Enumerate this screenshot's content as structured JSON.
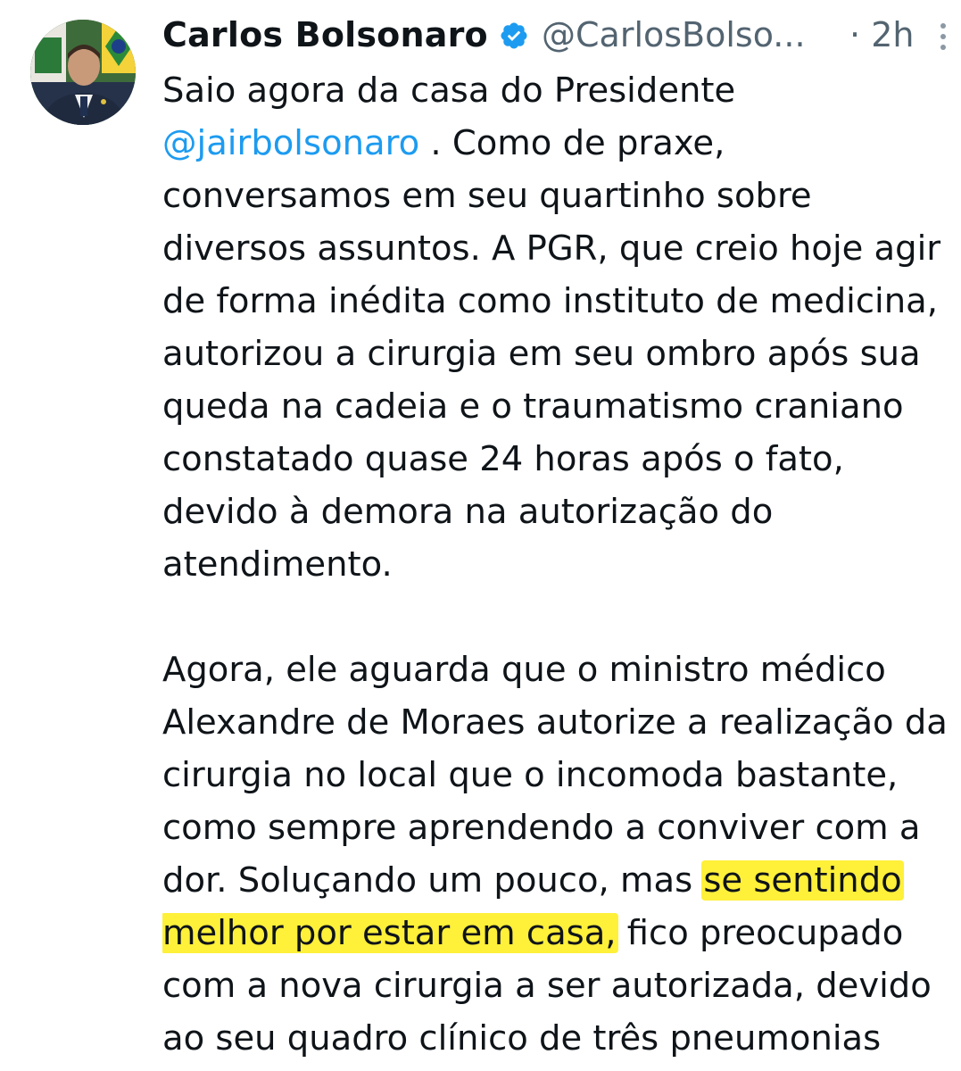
{
  "author": {
    "display_name": "Carlos Bolsonaro",
    "handle": "@CarlosBolso...",
    "time_prefix": "·",
    "time": "2h",
    "verified_icon": "verified-badge-icon",
    "more_icon": "more-vertical-icon"
  },
  "colors": {
    "mention": "#1d9bf0",
    "highlight": "#fff03a",
    "secondary_text": "#536471",
    "verified": "#1d9bf0"
  },
  "tweet": {
    "p1_l1": "Saio agora da casa do Presidente",
    "p1_l2_mention": "@jairbolsonaro",
    "p1_l2_rest": " . Como de praxe,",
    "p1_l3": "conversamos em seu quartinho sobre",
    "p1_l4": "diversos assuntos. A PGR, que creio hoje agir",
    "p1_l5": "de forma inédita como instituto de medicina,",
    "p1_l6": "autorizou a cirurgia em seu ombro após sua",
    "p1_l7": "queda na cadeia e o traumatismo craniano",
    "p1_l8": "constatado quase 24 horas após o fato,",
    "p1_l9": "devido à demora na autorização do",
    "p1_l10": "atendimento.",
    "p2_l1": "Agora, ele aguarda que o ministro médico",
    "p2_l2": "Alexandre de Moraes autorize a realização da",
    "p2_l3": "cirurgia no local que o incomoda bastante,",
    "p2_l4": "como sempre aprendendo a conviver com a",
    "p2_l5_pre": "dor. Soluçando um pouco, mas ",
    "p2_l5_hl": "se sentindo",
    "p2_l6_hl": "melhor por estar em casa,",
    "p2_l6_post": " fico preocupado",
    "p2_l7": "com a nova cirurgia a ser autorizada, devido",
    "p2_l8": "ao seu quadro clínico de três pneumonias"
  }
}
